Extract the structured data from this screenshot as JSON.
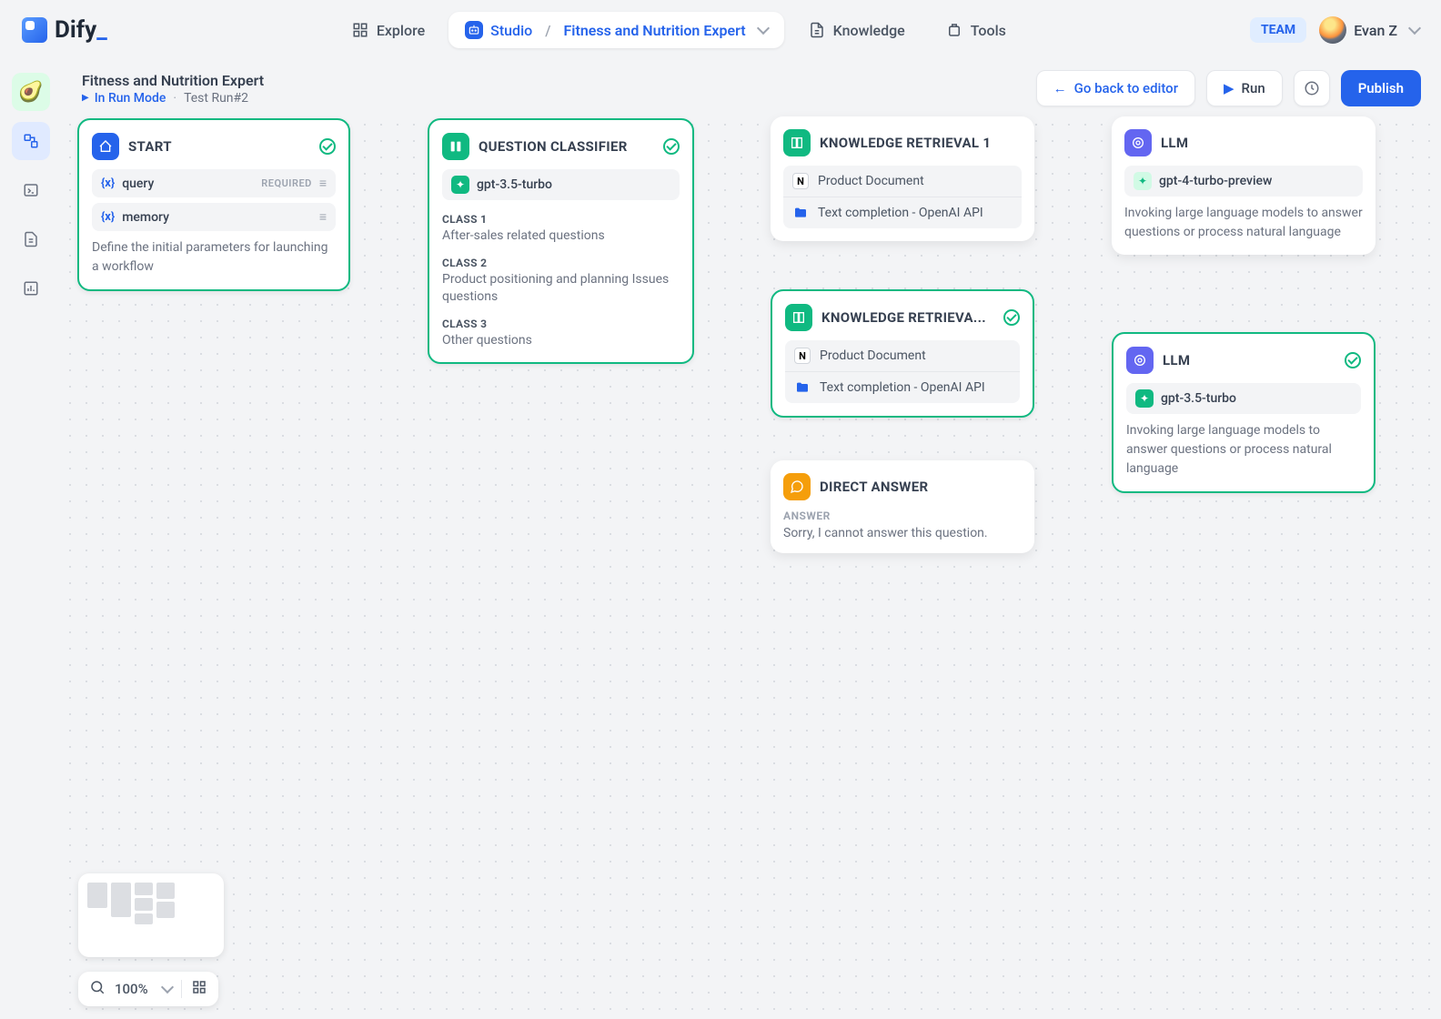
{
  "brand": {
    "name": "Dify"
  },
  "nav": {
    "explore": "Explore",
    "studio": "Studio",
    "knowledge": "Knowledge",
    "tools": "Tools",
    "app_name": "Fitness and Nutrition Expert",
    "team_badge": "TEAM",
    "user_name": "Evan Z"
  },
  "header": {
    "app_title": "Fitness and Nutrition Expert",
    "run_mode": "In Run Mode",
    "test_run": "Test Run#2",
    "back_button": "Go back to editor",
    "run_button": "Run",
    "publish_button": "Publish"
  },
  "zoom": {
    "level": "100%"
  },
  "nodes": {
    "start": {
      "title": "START",
      "var1": "query",
      "var1_req": "REQUIRED",
      "var2": "memory",
      "desc": "Define the initial parameters for launching a workflow"
    },
    "classifier": {
      "title": "QUESTION CLASSIFIER",
      "model": "gpt-3.5-turbo",
      "c1_label": "CLASS 1",
      "c1_text": "After-sales related questions",
      "c2_label": "CLASS 2",
      "c2_text": "Product positioning and planning Issues questions",
      "c3_label": "CLASS 3",
      "c3_text": "Other questions"
    },
    "kr1": {
      "title": "KNOWLEDGE RETRIEVAL 1",
      "doc1": "Product Document",
      "doc2": "Text completion - OpenAI API"
    },
    "kr2": {
      "title": "KNOWLEDGE RETRIEVA...",
      "doc1": "Product Document",
      "doc2": "Text completion - OpenAI API"
    },
    "llm1": {
      "title": "LLM",
      "model": "gpt-4-turbo-preview",
      "desc": "Invoking large language models to answer questions or process natural language"
    },
    "llm2": {
      "title": "LLM",
      "model": "gpt-3.5-turbo",
      "desc": "Invoking large language models to answer questions or process natural language"
    },
    "direct": {
      "title": "DIRECT ANSWER",
      "answer_label": "ANSWER",
      "answer_text": "Sorry, I cannot answer this question."
    }
  }
}
